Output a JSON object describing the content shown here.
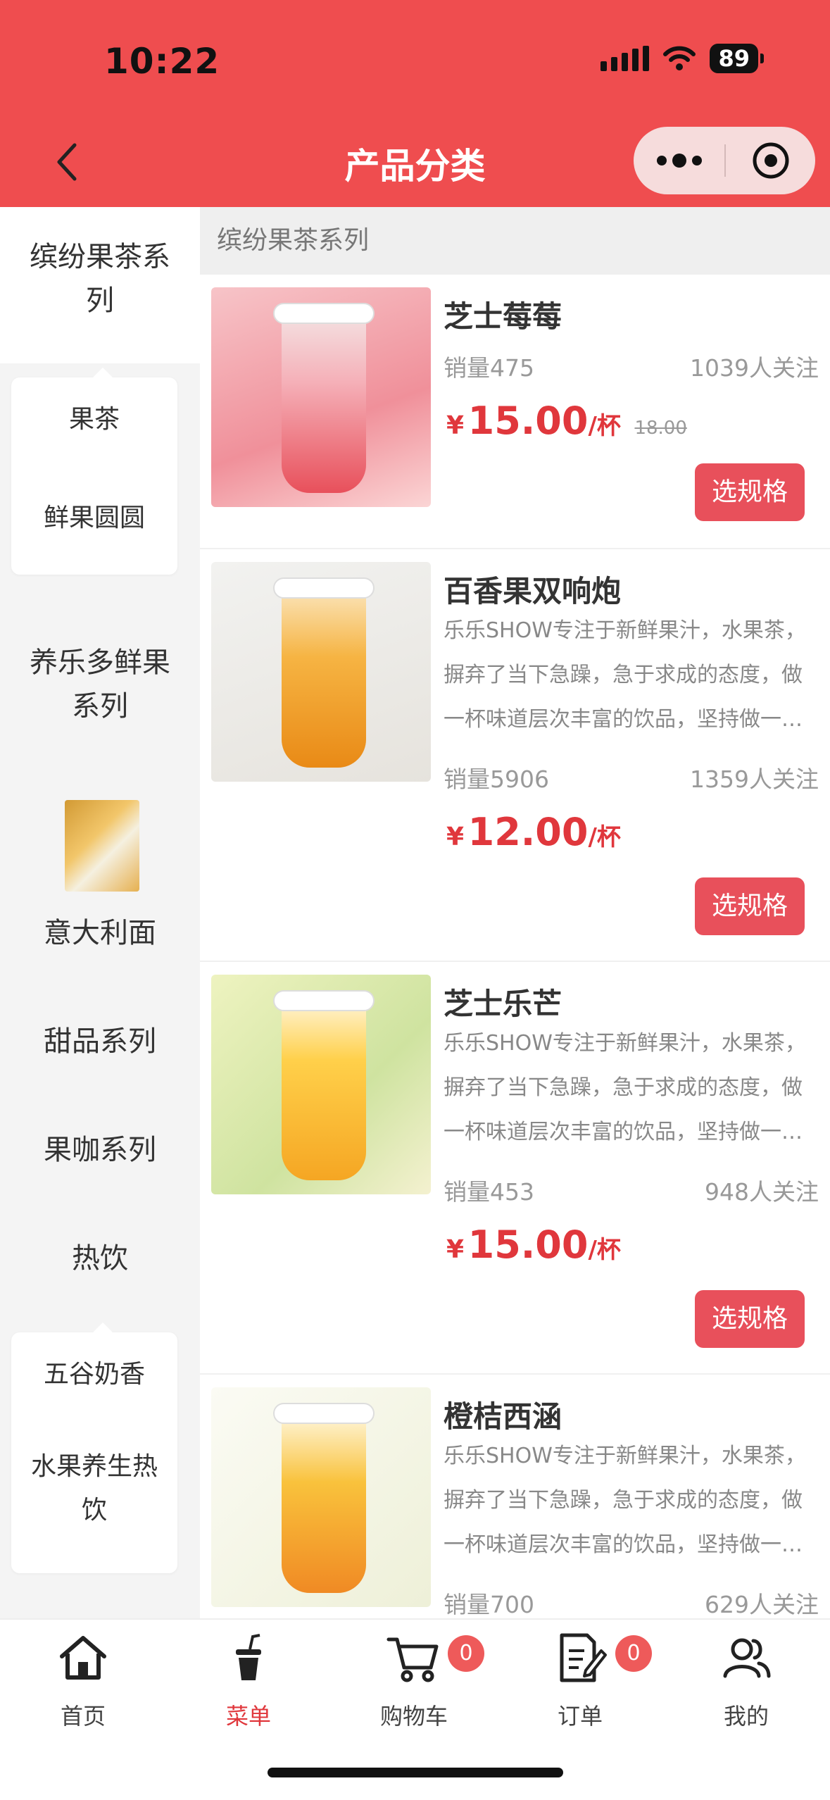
{
  "status": {
    "time": "10:22",
    "battery": "89"
  },
  "nav": {
    "title": "产品分类"
  },
  "sidebar": {
    "categories": [
      {
        "label": "缤纷果茶系列"
      },
      {
        "label": "养乐多鲜果系列"
      },
      {
        "label": "意大利面"
      },
      {
        "label": "甜品系列"
      },
      {
        "label": "果咖系列"
      },
      {
        "label": "热饮"
      }
    ],
    "sub_fruit_tea": [
      {
        "label": "果茶"
      },
      {
        "label": "鲜果圆圆"
      }
    ],
    "sub_hot": [
      {
        "label": "五谷奶香"
      },
      {
        "label": "水果养生热饮"
      }
    ]
  },
  "content": {
    "section_title": "缤纷果茶系列",
    "products": [
      {
        "name": "芝士莓莓",
        "desc": "",
        "sales": "销量475",
        "follow": "1039人关注",
        "price_symbol": "¥",
        "price": "15.00",
        "unit": "/杯",
        "orig_price": "18.00",
        "button": "选规格"
      },
      {
        "name": "百香果双响炮",
        "desc": "乐乐SHOW专注于新鲜果汁，水果茶，摒弃了当下急躁，急于求成的态度，做一杯味道层次丰富的饮品，坚持做一…",
        "sales": "销量5906",
        "follow": "1359人关注",
        "price_symbol": "¥",
        "price": "12.00",
        "unit": "/杯",
        "button": "选规格"
      },
      {
        "name": "芝士乐芒",
        "desc": "乐乐SHOW专注于新鲜果汁，水果茶，摒弃了当下急躁，急于求成的态度，做一杯味道层次丰富的饮品，坚持做一…",
        "sales": "销量453",
        "follow": "948人关注",
        "price_symbol": "¥",
        "price": "15.00",
        "unit": "/杯",
        "button": "选规格"
      },
      {
        "name": "橙桔西涵",
        "desc": "乐乐SHOW专注于新鲜果汁，水果茶，摒弃了当下急躁，急于求成的态度，做一杯味道层次丰富的饮品，坚持做一…",
        "sales": "销量700",
        "follow": "629人关注"
      }
    ]
  },
  "tabbar": {
    "tabs": [
      {
        "label": "首页"
      },
      {
        "label": "菜单"
      },
      {
        "label": "购物车",
        "badge": "0"
      },
      {
        "label": "订单",
        "badge": "0"
      },
      {
        "label": "我的"
      }
    ]
  },
  "colors": {
    "brand": "#ef4d4f",
    "price": "#e0373c",
    "button": "#e8505b"
  }
}
